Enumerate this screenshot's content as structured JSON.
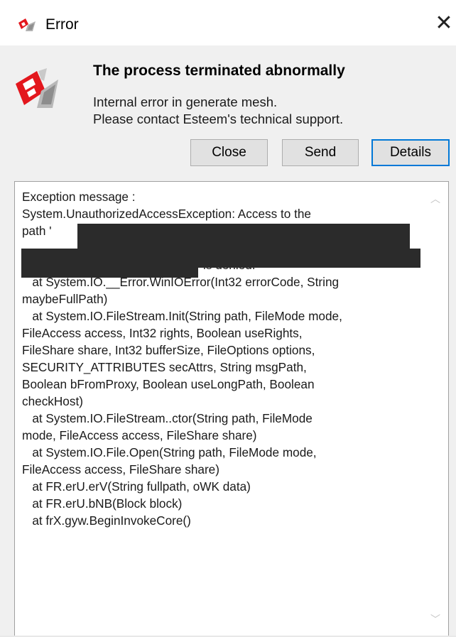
{
  "window": {
    "title": "Error",
    "close_glyph": "✕"
  },
  "icons": {
    "title_logo": "esteem-logo-icon",
    "dialog_logo": "esteem-logo-icon",
    "brand_color": "#e3171d"
  },
  "header": {
    "headline": "The process terminated abnormally",
    "message_line1": "Internal error in generate mesh.",
    "message_line2": "Please contact Esteem's technical support."
  },
  "buttons": {
    "close_label": "Close",
    "send_label": "Send",
    "details_label": "Details"
  },
  "details": {
    "line_01": "Exception message :",
    "line_02": "System.UnauthorizedAccessException: Access to the",
    "line_03": "path '",
    "line_04": "",
    "line_05": "is denied.",
    "line_06": "   at System.IO.__Error.WinIOError(Int32 errorCode, String",
    "line_07": "maybeFullPath)",
    "line_08": "   at System.IO.FileStream.Init(String path, FileMode mode,",
    "line_09": "FileAccess access, Int32 rights, Boolean useRights,",
    "line_10": "FileShare share, Int32 bufferSize, FileOptions options,",
    "line_11": "SECURITY_ATTRIBUTES secAttrs, String msgPath,",
    "line_12": "Boolean bFromProxy, Boolean useLongPath, Boolean",
    "line_13": "checkHost)",
    "line_14": "   at System.IO.FileStream..ctor(String path, FileMode",
    "line_15": "mode, FileAccess access, FileShare share)",
    "line_16": "   at System.IO.File.Open(String path, FileMode mode,",
    "line_17": "FileAccess access, FileShare share)",
    "line_18": "   at FR.erU.erV(String fullpath, oWK data)",
    "line_19": "   at FR.erU.bNB(Block block)",
    "line_20": "   at frX.gyw.BeginInvokeCore()"
  },
  "scrollbar": {
    "up_glyph": "︿",
    "down_glyph": "﹀"
  }
}
